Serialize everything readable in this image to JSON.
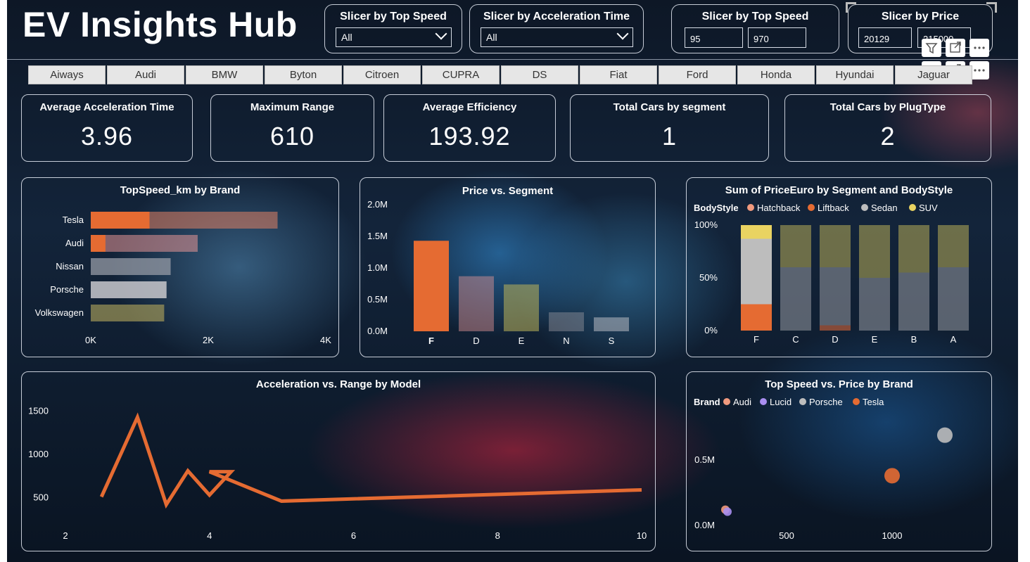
{
  "title": "EV Insights Hub",
  "slicers": [
    {
      "title": "Slicer by Top Speed",
      "value": "All"
    },
    {
      "title": "Slicer by Acceleration Time",
      "value": "All"
    },
    {
      "title": "Slicer by Top Speed",
      "min": "95",
      "max": "970"
    },
    {
      "title": "Slicer by Price",
      "min": "20129",
      "max": "215000"
    }
  ],
  "brand_tabs": [
    "Aiways",
    "Audi",
    "BMW",
    "Byton",
    "Citroen",
    "CUPRA",
    "DS",
    "Fiat",
    "Ford",
    "Honda",
    "Hyundai",
    "Jaguar"
  ],
  "kpis": [
    {
      "label": "Average Acceleration Time",
      "value": "3.96"
    },
    {
      "label": "Maximum Range",
      "value": "610"
    },
    {
      "label": "Average Efficiency",
      "value": "193.92"
    },
    {
      "label": "Total Cars by segment",
      "value": "1"
    },
    {
      "label": "Total Cars by PlugType",
      "value": "2"
    }
  ],
  "colors": {
    "orange": "#e56b32",
    "peach": "#f19a7e",
    "grey": "#bdbdbd",
    "yellow": "#e9d361",
    "purple": "#a98ef0"
  },
  "chart_data": [
    {
      "type": "bar",
      "orientation": "horizontal",
      "title": "TopSpeed_km by Brand",
      "categories": [
        "Tesla",
        "Audi",
        "Nissan",
        "Porsche",
        "Volkswagen"
      ],
      "values": [
        3180,
        1820,
        1360,
        1290,
        1250
      ],
      "highlight_values": [
        1000,
        250,
        null,
        null,
        null
      ],
      "xticks": [
        "0K",
        "2K",
        "4K"
      ],
      "xlim": [
        0,
        4000
      ]
    },
    {
      "type": "bar",
      "title": "Price vs. Segment",
      "categories": [
        "F",
        "D",
        "E",
        "N",
        "S"
      ],
      "values": [
        1430000,
        870000,
        740000,
        300000,
        220000
      ],
      "highlight_values": [
        1430000,
        null,
        null,
        null,
        null
      ],
      "yticks": [
        "0.0M",
        "0.5M",
        "1.0M",
        "1.5M",
        "2.0M"
      ],
      "ylim": [
        0,
        2000000
      ]
    },
    {
      "type": "bar",
      "stacked": "100%",
      "title": "Sum of PriceEuro by Segment and BodyStyle",
      "legend_title": "BodyStyle",
      "legend": [
        "Hatchback",
        "Liftback",
        "Sedan",
        "SUV"
      ],
      "categories": [
        "F",
        "C",
        "D",
        "E",
        "B",
        "A"
      ],
      "series": [
        {
          "name": "Hatchback",
          "values": [
            0,
            0,
            0,
            0,
            0,
            0
          ]
        },
        {
          "name": "Liftback",
          "values": [
            0.25,
            0,
            0.05,
            0,
            0,
            0
          ]
        },
        {
          "name": "Sedan",
          "values": [
            0.62,
            0.6,
            0.55,
            0.5,
            0.55,
            0.6
          ]
        },
        {
          "name": "SUV",
          "values": [
            0.13,
            0.4,
            0.4,
            0.5,
            0.45,
            0.4
          ]
        }
      ],
      "yticks": [
        "0%",
        "50%",
        "100%"
      ]
    },
    {
      "type": "line",
      "title": "Acceleration vs. Range by Model",
      "x": [
        2.5,
        3.0,
        3.4,
        3.7,
        4.0,
        4.3,
        4.0,
        5.0,
        10.0
      ],
      "y": [
        500,
        1420,
        410,
        800,
        520,
        790,
        790,
        450,
        580
      ],
      "xticks": [
        "2",
        "4",
        "6",
        "8",
        "10"
      ],
      "yticks": [
        "500",
        "1000",
        "1500"
      ],
      "xlim": [
        2,
        10
      ],
      "ylim": [
        250,
        1650
      ]
    },
    {
      "type": "scatter",
      "title": "Top Speed vs. Price by Brand",
      "legend_title": "Brand",
      "legend": [
        "Audi",
        "Lucid",
        "Porsche",
        "Tesla"
      ],
      "series": [
        {
          "name": "Audi",
          "points": [
            [
              210,
              120000
            ]
          ]
        },
        {
          "name": "Lucid",
          "points": [
            [
              220,
              105000
            ]
          ]
        },
        {
          "name": "Porsche",
          "points": [
            [
              1250,
              690000
            ]
          ]
        },
        {
          "name": "Tesla",
          "points": [
            [
              1000,
              380000
            ]
          ]
        }
      ],
      "xticks": [
        "500",
        "1000"
      ],
      "yticks": [
        "0.0M",
        "0.5M"
      ]
    }
  ]
}
